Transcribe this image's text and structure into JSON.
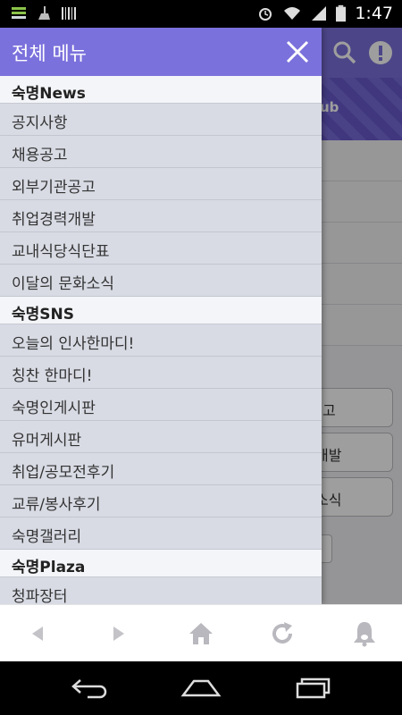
{
  "status_bar": {
    "time": "1:47",
    "icons": [
      "notification-bars-icon",
      "cleaner-icon",
      "barcode-icon",
      "alarm-icon",
      "wifi-icon",
      "signal-icon",
      "battery-icon"
    ]
  },
  "background_app": {
    "banner_text_fragment": "ub",
    "button_fragments": [
      "고",
      "개발",
      "소식"
    ],
    "header_icons": [
      "search-icon",
      "alert-icon"
    ]
  },
  "drawer": {
    "title": "전체 메뉴",
    "sections": [
      {
        "header": "숙명News",
        "items": [
          "공지사항",
          "채용공고",
          "외부기관공고",
          "취업경력개발",
          "교내식당식단표",
          "이달의 문화소식"
        ]
      },
      {
        "header": "숙명SNS",
        "items": [
          "오늘의 인사한마디!",
          "칭찬 한마디!",
          "숙명인게시판",
          "유머게시판",
          "취업/공모전후기",
          "교류/봉사후기",
          "숙명갤러리"
        ]
      },
      {
        "header": "숙명Plaza",
        "items": [
          "청파장터"
        ]
      }
    ]
  },
  "toolbar": {
    "buttons": [
      "back-icon",
      "forward-icon",
      "home-icon",
      "refresh-icon",
      "bell-icon"
    ]
  },
  "navbar": {
    "buttons": [
      "back-nav-icon",
      "home-nav-icon",
      "recents-nav-icon"
    ]
  },
  "colors": {
    "accent": "#7b71dc",
    "drawer_bg": "#d8dbe4",
    "section_bg": "#f4f5f8"
  }
}
